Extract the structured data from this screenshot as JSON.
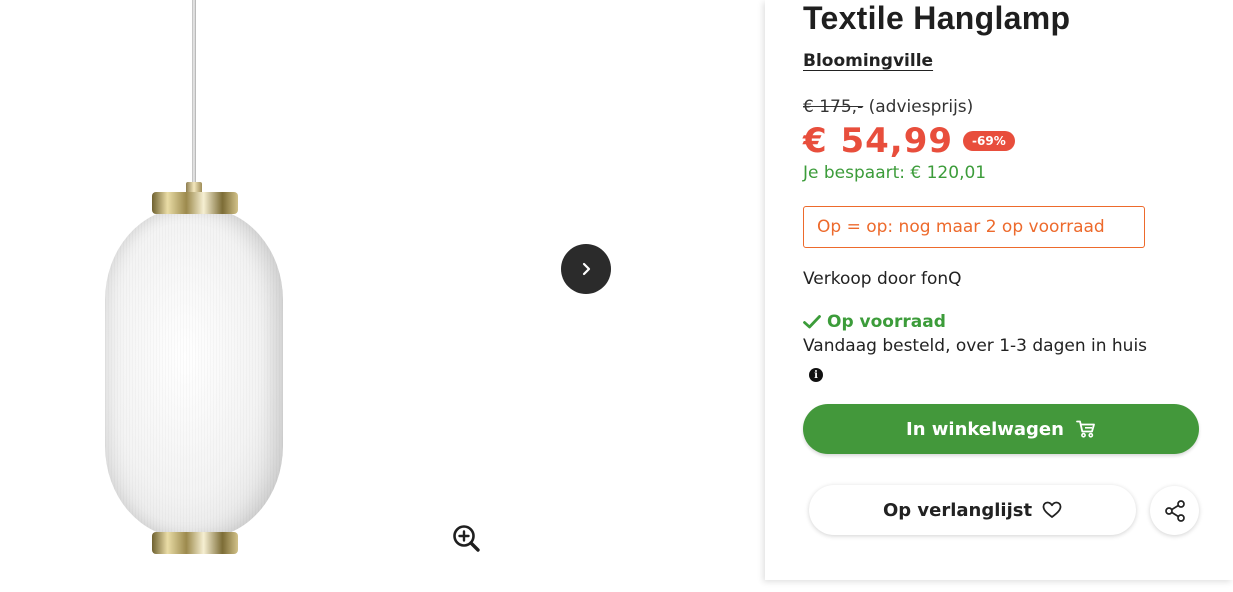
{
  "product": {
    "title": "Textile Hanglamp",
    "brand": "Bloomingville",
    "old_price": "€ 175,-",
    "old_price_note": "(adviesprijs)",
    "price": "€ 54,99",
    "discount": "-69%",
    "savings": "Je bespaart: € 120,01",
    "stock_warning": "Op = op: nog maar 2 op voorraad",
    "seller": "Verkoop door fonQ",
    "stock_status": "Op voorraad",
    "delivery": "Vandaag besteld, over 1-3 dagen in huis"
  },
  "actions": {
    "cart_label": "In winkelwagen",
    "wishlist_label": "Op verlanglijst"
  },
  "icons": {
    "next": "chevron-right-icon",
    "zoom": "zoom-in-icon",
    "check": "check-icon",
    "info": "info-icon",
    "cart": "cart-icon",
    "heart": "heart-icon",
    "share": "share-icon"
  },
  "colors": {
    "price_red": "#e84e3c",
    "green": "#43983b",
    "warning_orange": "#ed6a2c"
  }
}
